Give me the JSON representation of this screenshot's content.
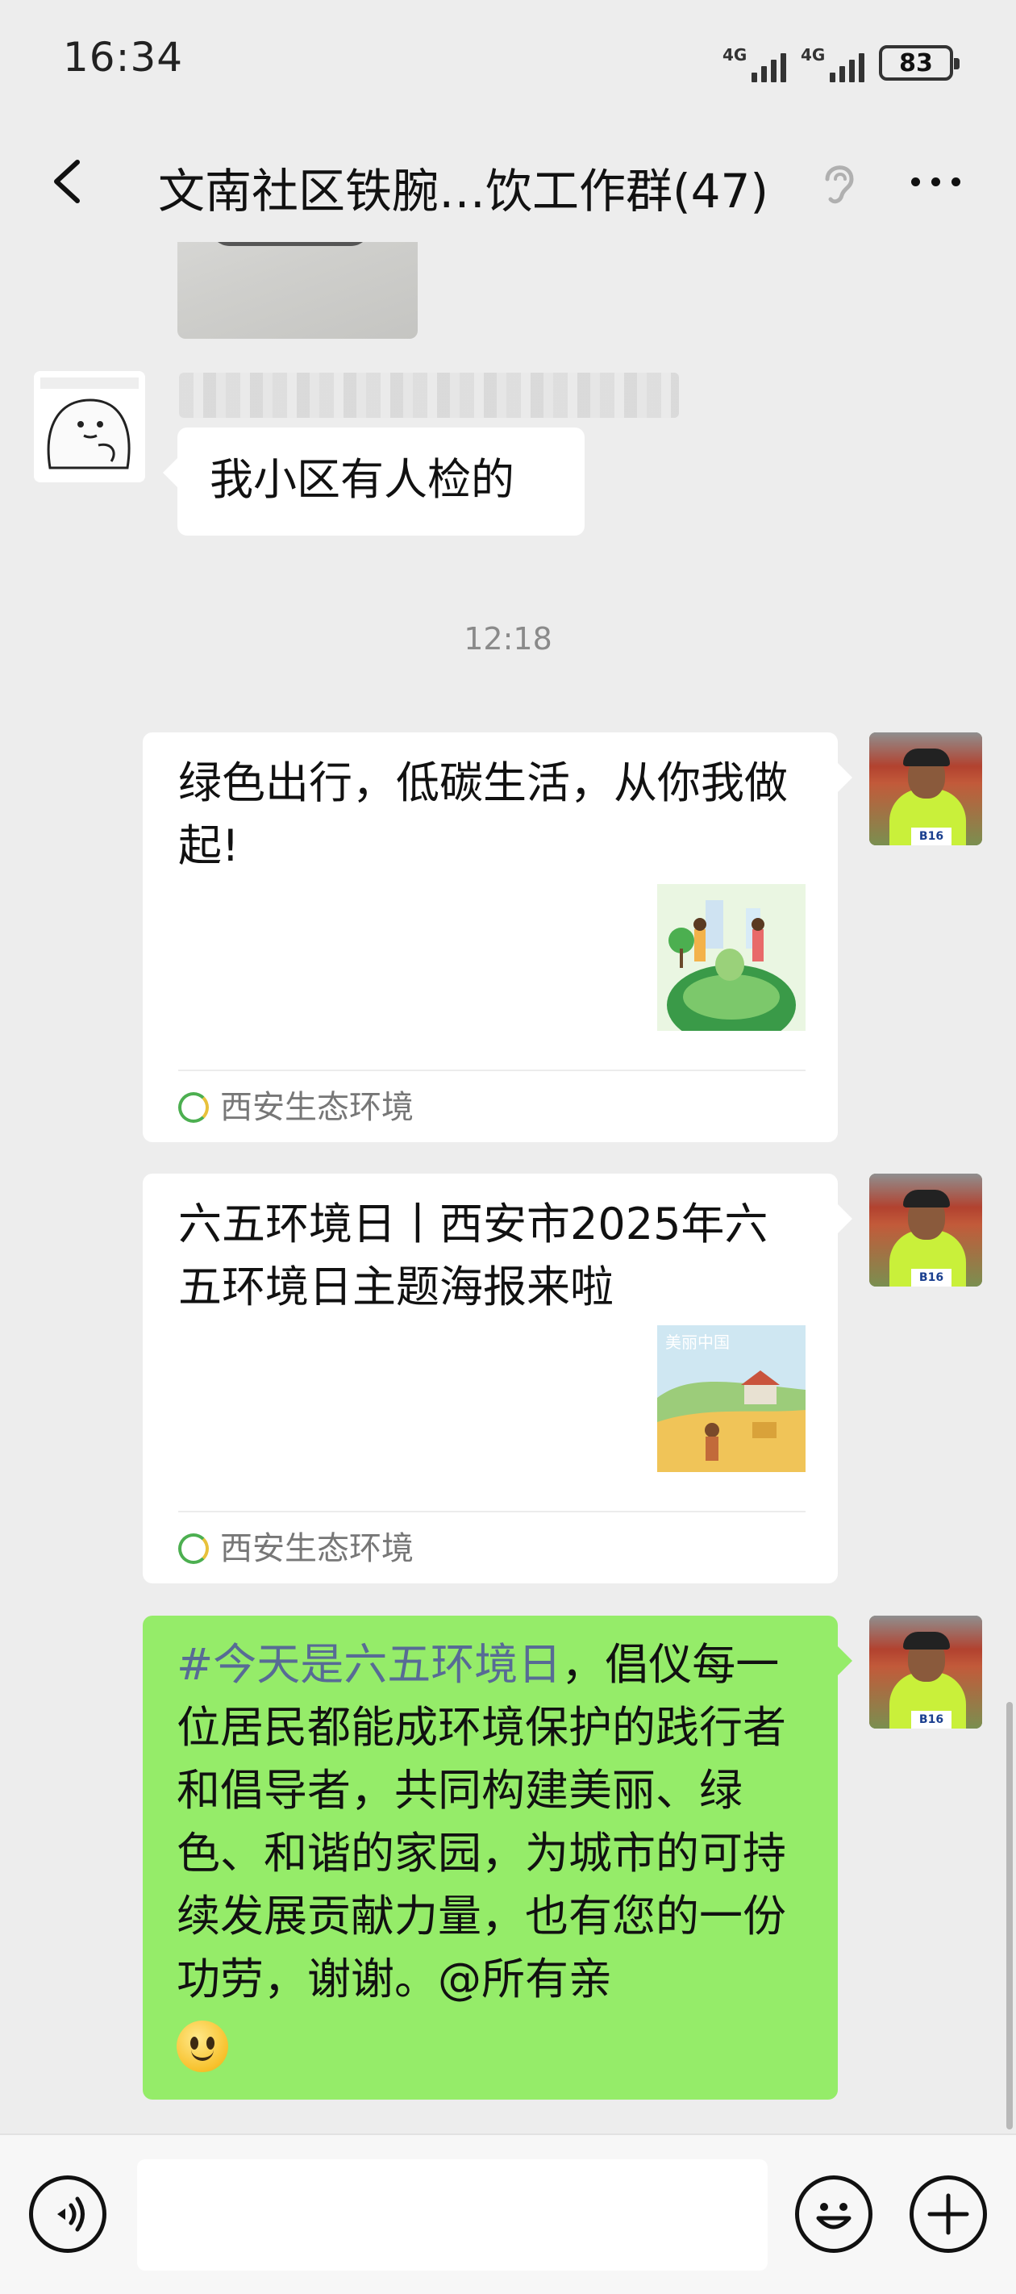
{
  "status_bar": {
    "time": "16:34",
    "signal1_label": "4G",
    "signal2_label": "4G",
    "battery": "83"
  },
  "nav": {
    "title": "文南社区铁腕…饮工作群(47)",
    "icons": [
      "back-chevron-icon",
      "ear-icon",
      "more-dots-icon"
    ]
  },
  "messages": {
    "msg1_text": "我小区有人检的",
    "timestamp": "12:18",
    "card1": {
      "title": "绿色出行，低碳生活，从你我做起!",
      "source": "西安生态环境"
    },
    "card2": {
      "title": "六五环境日丨西安市2025年六五环境日主题海报来啦",
      "source": "西安生态环境"
    },
    "msg3": {
      "hashtag": "#今天是六五环境日",
      "text": "，倡仪每一位居民都能成环境保护的践行者和倡导者，共同构建美丽、绿色、和谐的家园，为城市的可持续发展贡献力量，也有您的一份功劳，谢谢。@所有亲"
    }
  },
  "colors": {
    "background": "#ededed",
    "green_bubble": "#95ec69",
    "hashtag_link": "#576b95"
  },
  "input_bar": {
    "icons": [
      "voice-icon",
      "emoji-icon",
      "plus-icon"
    ]
  }
}
